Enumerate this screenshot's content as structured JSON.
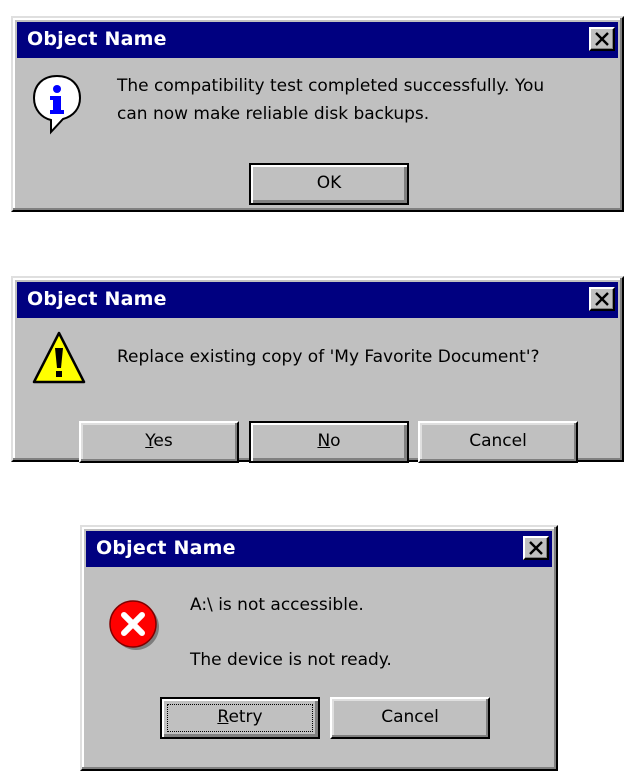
{
  "colors": {
    "face": "#c0c0c0",
    "title_bar": "#000080",
    "title_text": "#ffffff",
    "error_red": "#ff0000",
    "warning_yellow": "#ffff00",
    "info_blue": "#0000ff"
  },
  "info_dialog": {
    "title": "Object Name",
    "close_icon": "close-x-icon",
    "icon": "information-icon",
    "message_line1": "The compatibility test completed successfully. You",
    "message_line2": "can now make reliable disk backups.",
    "ok_label": "OK"
  },
  "warning_dialog": {
    "title": "Object Name",
    "close_icon": "close-x-icon",
    "icon": "warning-icon",
    "message": "Replace existing copy of 'My Favorite Document'?",
    "yes_first": "Y",
    "yes_rest": "es",
    "no_first": "N",
    "no_rest": "o",
    "cancel_label": "Cancel"
  },
  "error_dialog": {
    "title": "Object Name",
    "close_icon": "close-x-icon",
    "icon": "error-icon",
    "message_line1": "A:\\ is not accessible.",
    "message_line2": "The device is not ready.",
    "retry_first": "R",
    "retry_rest": "etry",
    "cancel_label": "Cancel"
  }
}
